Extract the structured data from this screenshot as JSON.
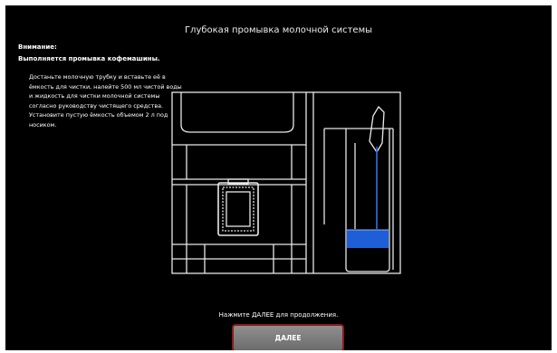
{
  "header": {
    "title": "Глубокая промывка молочной системы"
  },
  "warning": {
    "label": "Внимание:",
    "text": "Выполняется промывка кофемашины."
  },
  "instructions": {
    "paragraph1": "Достаньте молочную трубку и вставьте её в ёмкость для чистки, налейте 500 мл чистой воды и жидкость для чистки молочной системы согласно руководству чистящего средства.",
    "paragraph2": "Установите пустую ёмкость объемом 2 л под носиком."
  },
  "illustration": {
    "icon": "coffee-machine-milk-cleaning-diagram"
  },
  "footer": {
    "hint": "Нажмите ДАЛЕЕ для продолжения.",
    "next_label": "ДАЛЕЕ"
  },
  "colors": {
    "background": "#000000",
    "text": "#ffffff",
    "line": "#e8e8e8",
    "liquid": "#1e5fd8",
    "button": "#7b7b7b",
    "button_border": "#8b1b1b"
  }
}
